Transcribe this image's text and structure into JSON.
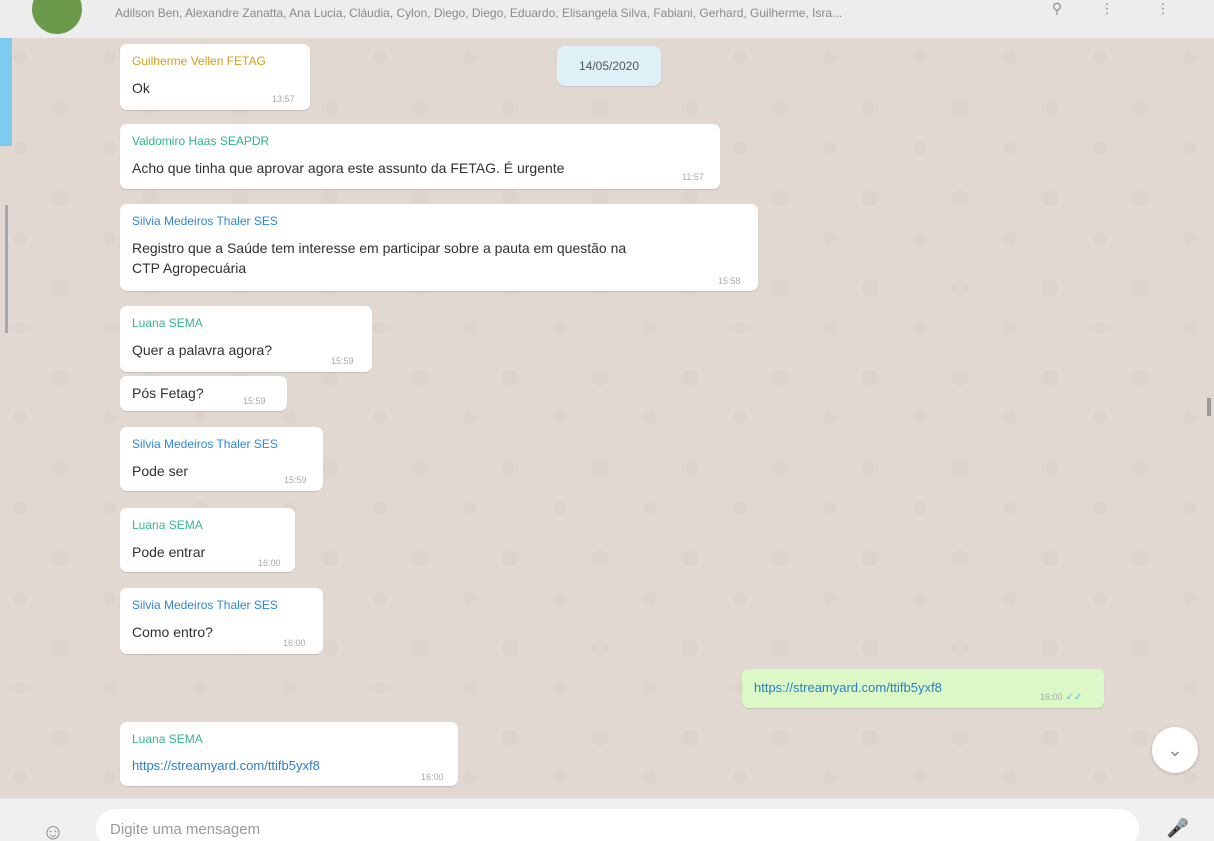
{
  "header": {
    "participants": "Adilson Ben, Alexandre Zanatta, Ana Lucia, Cláudia, Cylon, Diego, Diego, Eduardo, Elisangela Silva, Fabiani, Gerhard, Guilherme, Isra..."
  },
  "date_label": "14/05/2020",
  "messages": [
    {
      "sender": "Guilherme Vellen FETAG",
      "text": "Ok",
      "time": "13:57"
    },
    {
      "sender": "Valdomiro Haas SEAPDR",
      "text": "Acho que tinha que aprovar agora este assunto da FETAG. É urgente",
      "time": "11:57"
    },
    {
      "sender": "Silvia Medeiros Thaler SES",
      "text_line1": "Registro que a Saúde tem interesse em participar sobre a pauta em questão na",
      "text_line2": "CTP Agropecuária",
      "time": "15:58"
    },
    {
      "sender": "Luana SEMA",
      "text": "Quer a palavra agora?",
      "time": "15:59"
    },
    {
      "text": "Pós Fetag?",
      "time": "15:59"
    },
    {
      "sender": "Silvia Medeiros Thaler SES",
      "text": "Pode ser",
      "time": "15:59"
    },
    {
      "sender": "Luana SEMA",
      "text": "Pode entrar",
      "time": "16:00"
    },
    {
      "sender": "Silvia Medeiros Thaler SES",
      "text": "Como entro?",
      "time": "16:00"
    },
    {
      "text": "https://streamyard.com/ttifb5yxf8",
      "time": "16:00"
    },
    {
      "sender": "Luana SEMA",
      "text": "https://streamyard.com/ttifb5yxf8",
      "time": "16:00"
    }
  ],
  "composer": {
    "placeholder": "Digite uma mensagem"
  },
  "colors": {
    "chat_background": "#e1d9d1",
    "incoming_bubble": "#ffffff",
    "outgoing_bubble": "#dcf8c6",
    "date_pill": "#dff0f7",
    "sender_guilherme": "#d4a017",
    "sender_valdomiro": "#2bb58a",
    "sender_silvia": "#2e86d9",
    "sender_luana": "#33b88c",
    "link": "#2a7ec6"
  },
  "icons": {
    "emoji": "smiley-icon",
    "mic": "microphone-icon",
    "scroll_down": "chevron-down-icon",
    "read_receipt": "double-check-icon",
    "header_search": "search-icon",
    "header_attach": "paperclip-icon",
    "header_menu": "menu-icon"
  }
}
